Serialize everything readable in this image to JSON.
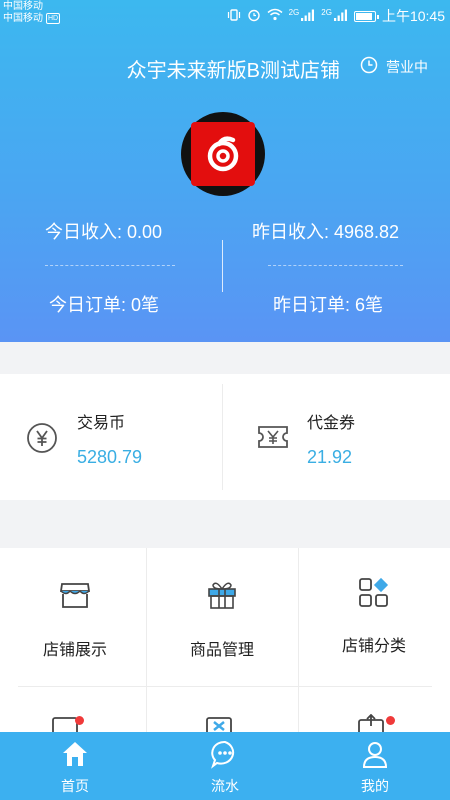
{
  "status_bar": {
    "carrier_1": "中国移动",
    "carrier_2": "中国移动",
    "sim_tag": "HD",
    "net_1": "2G",
    "net_2": "2G",
    "time": "上午10:45"
  },
  "header": {
    "store_name": "众宇未来新版B测试店铺",
    "open_status": "营业中"
  },
  "stats": {
    "today_income": "今日收入: 0.00",
    "yesterday_income": "昨日收入: 4968.82",
    "today_orders": "今日订单: 0笔",
    "yesterday_orders": "昨日订单: 6笔"
  },
  "wallet": {
    "coins_label": "交易币",
    "coins_value": "5280.79",
    "voucher_label": "代金券",
    "voucher_value": "21.92"
  },
  "grid": {
    "items": [
      {
        "label": "店铺展示",
        "icon": "storefront-icon"
      },
      {
        "label": "商品管理",
        "icon": "gift-icon"
      },
      {
        "label": "店铺分类",
        "icon": "category-icon"
      }
    ]
  },
  "tabbar": {
    "items": [
      {
        "label": "首页",
        "icon": "home-icon",
        "active": true
      },
      {
        "label": "流水",
        "icon": "chat-icon"
      },
      {
        "label": "我的",
        "icon": "user-icon"
      }
    ]
  },
  "colors": {
    "header_top": "#3cb8ef",
    "header_bottom": "#5a94f4",
    "accent_value": "#3aaee3",
    "tabbar": "#3cb0f0",
    "badge": "#f03a3a"
  }
}
